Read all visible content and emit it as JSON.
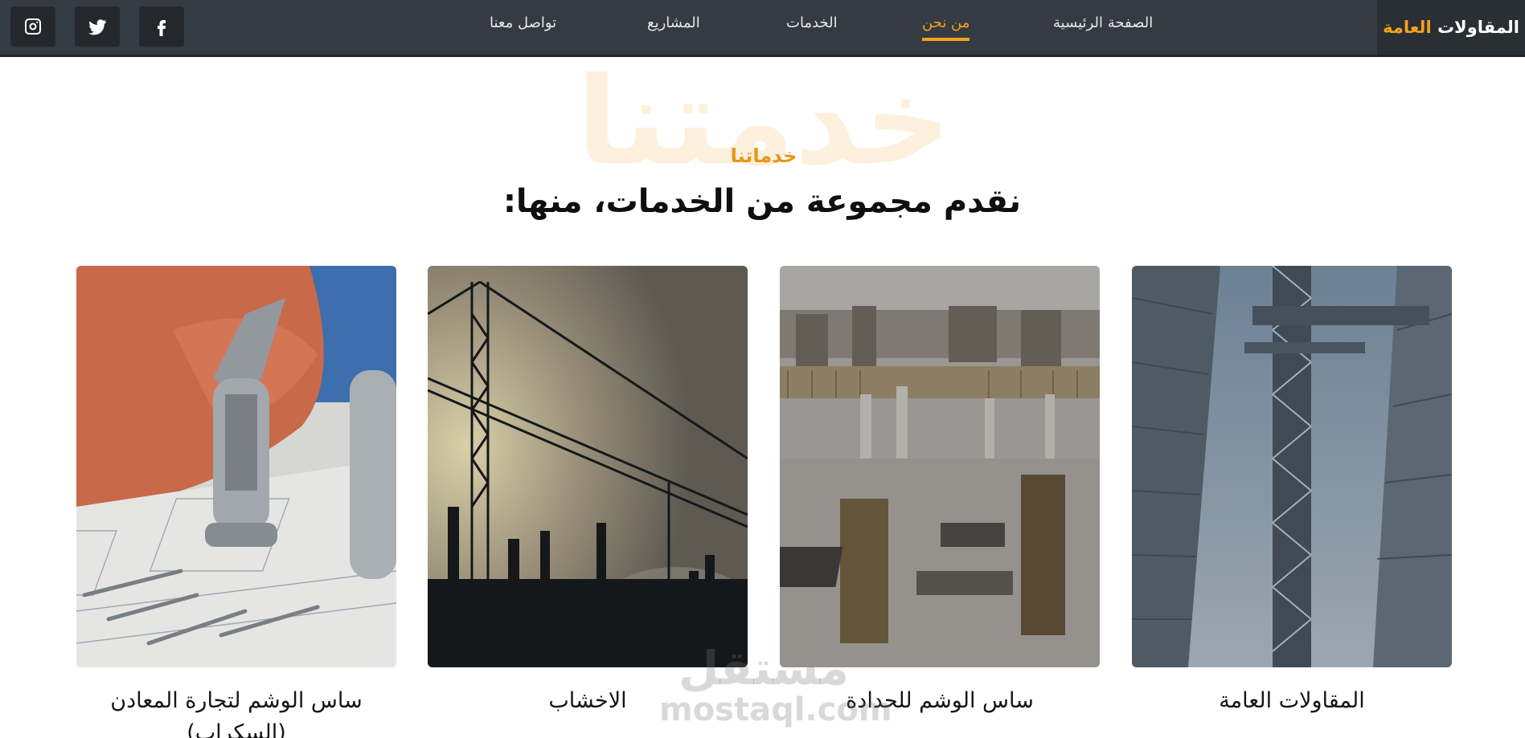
{
  "navbar": {
    "brand_main": "المقاولات",
    "brand_accent": "العامة",
    "links": [
      {
        "label": "الصفحة الرئيسية",
        "active": false
      },
      {
        "label": "من نحن",
        "active": true
      },
      {
        "label": "الخدمات",
        "active": false
      },
      {
        "label": "المشاريع",
        "active": false
      },
      {
        "label": "تواصل معنا",
        "active": false
      }
    ],
    "social": [
      "facebook-icon",
      "twitter-icon",
      "instagram-icon"
    ]
  },
  "section": {
    "ghost_title": "خدمتنا",
    "label": "خدماتنا",
    "heading": "نقدم مجموعة من الخدمات، منها:"
  },
  "cards": [
    {
      "title": "المقاولات العامة"
    },
    {
      "title": "ساس الوشم للحدادة"
    },
    {
      "title": "الاخشاب"
    },
    {
      "title": "ساس الوشم لتجارة المعادن (السكراب)"
    }
  ],
  "watermark": {
    "ar": "مستقل",
    "en": "mostaql.com"
  },
  "colors": {
    "accent": "#f5a21b",
    "navbar": "#353b42",
    "brand_bg": "#2a2f35"
  }
}
